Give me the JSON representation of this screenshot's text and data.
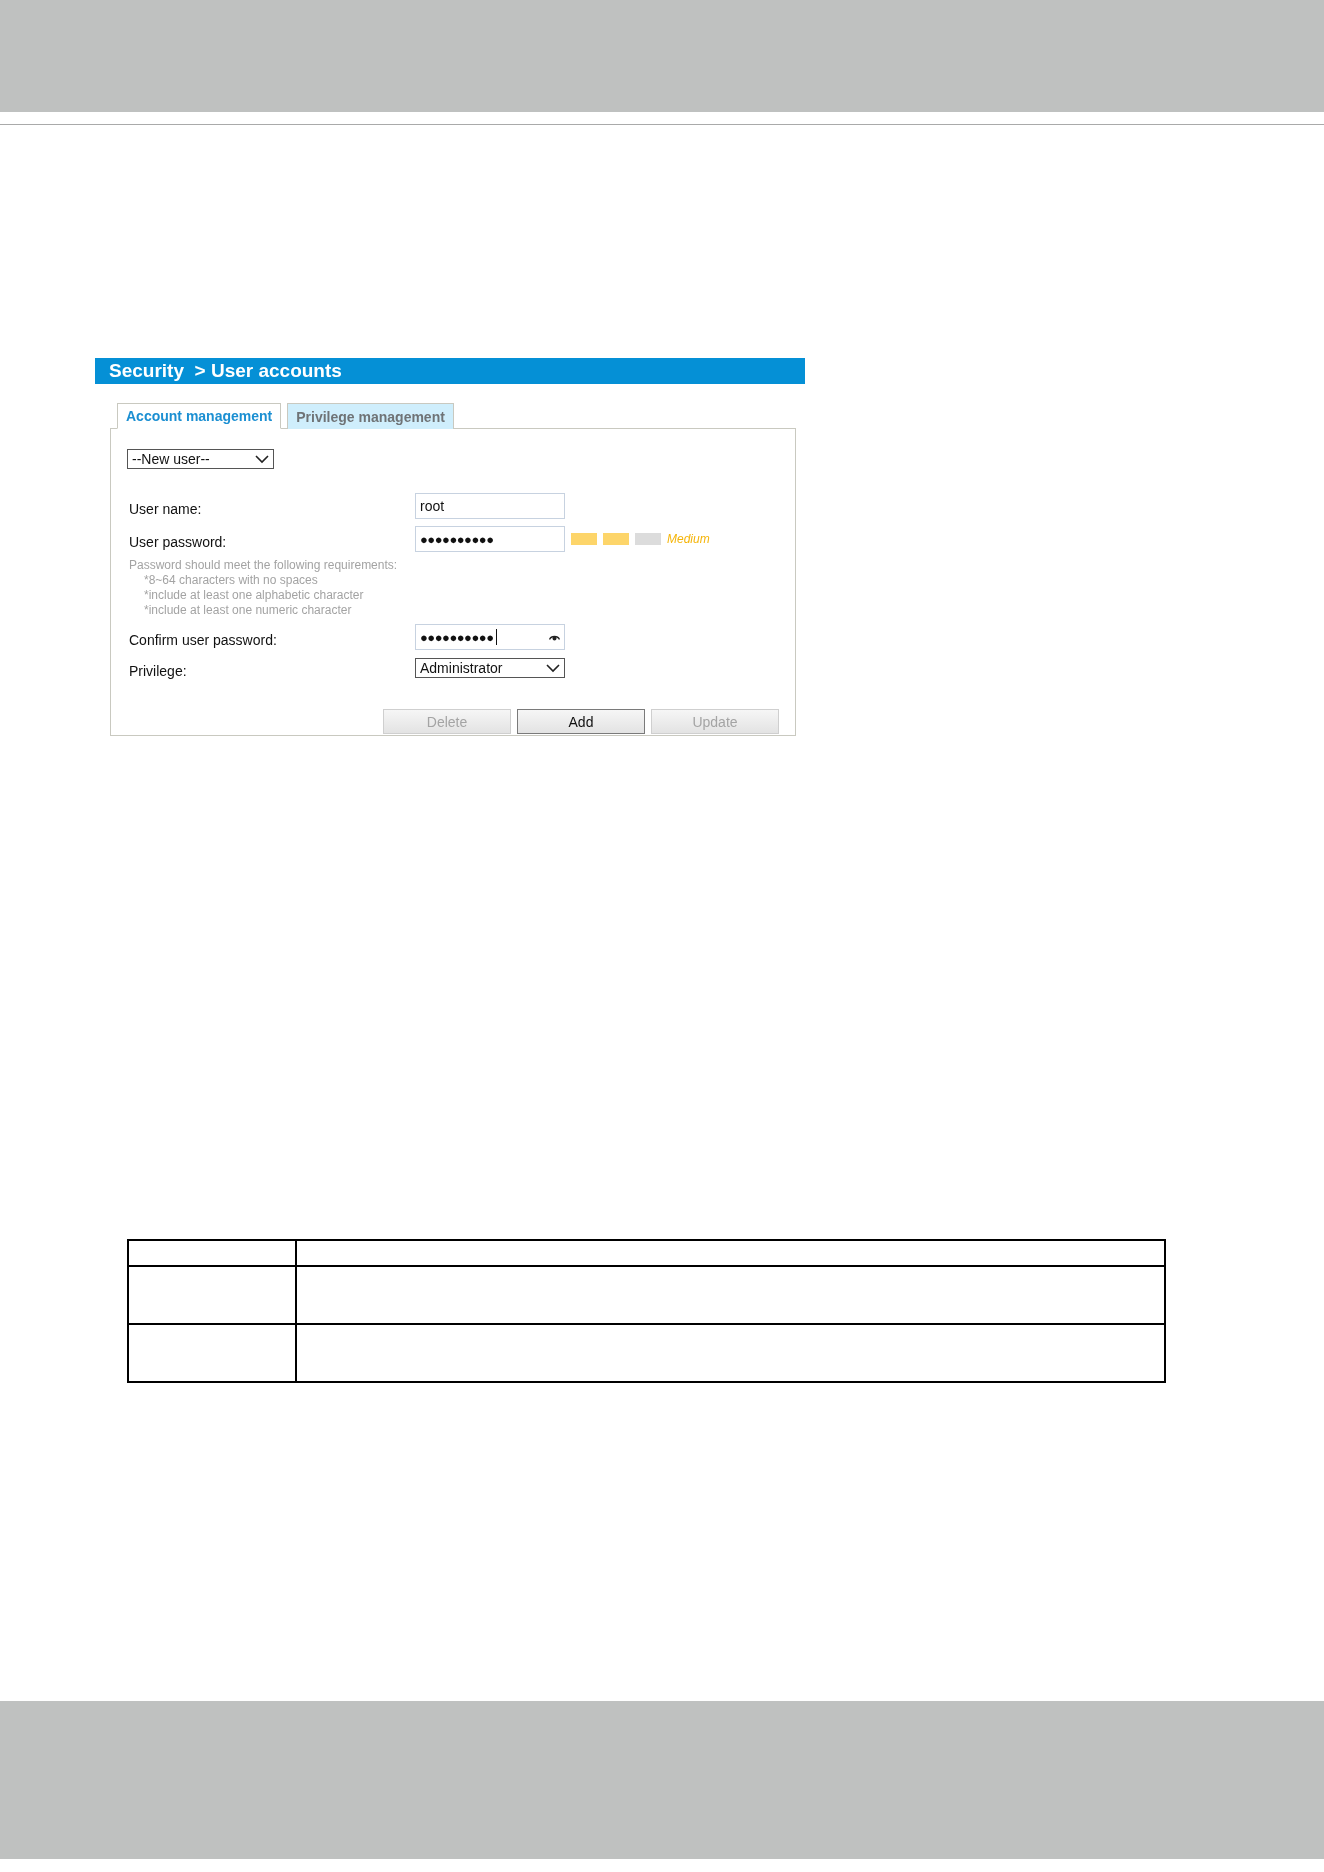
{
  "screenshot": {
    "breadcrumb": "Security  > User accounts",
    "tabs": [
      {
        "label": "Account management",
        "selected": true
      },
      {
        "label": "Privilege management",
        "selected": false
      }
    ],
    "user_select": {
      "value": "--New user--"
    },
    "user_name": {
      "label": "User name:",
      "value": "root"
    },
    "user_password": {
      "label": "User password:",
      "value": "●●●●●●●●●●",
      "strength": {
        "label": "Medium",
        "segments": [
          {
            "filled": true
          },
          {
            "filled": true
          },
          {
            "filled": false
          }
        ]
      }
    },
    "requirements": {
      "title": "Password should meet the following requirements:",
      "items": [
        "*8~64 characters with no spaces",
        "*include at least one alphabetic character",
        "*include at least one numeric character"
      ]
    },
    "confirm_password": {
      "label": "Confirm user password:",
      "value": "●●●●●●●●●●"
    },
    "privilege": {
      "label": "Privilege:",
      "value": "Administrator"
    },
    "buttons": [
      {
        "label": "Delete",
        "disabled": true
      },
      {
        "label": "Add",
        "disabled": false
      },
      {
        "label": "Update",
        "disabled": true
      }
    ]
  }
}
